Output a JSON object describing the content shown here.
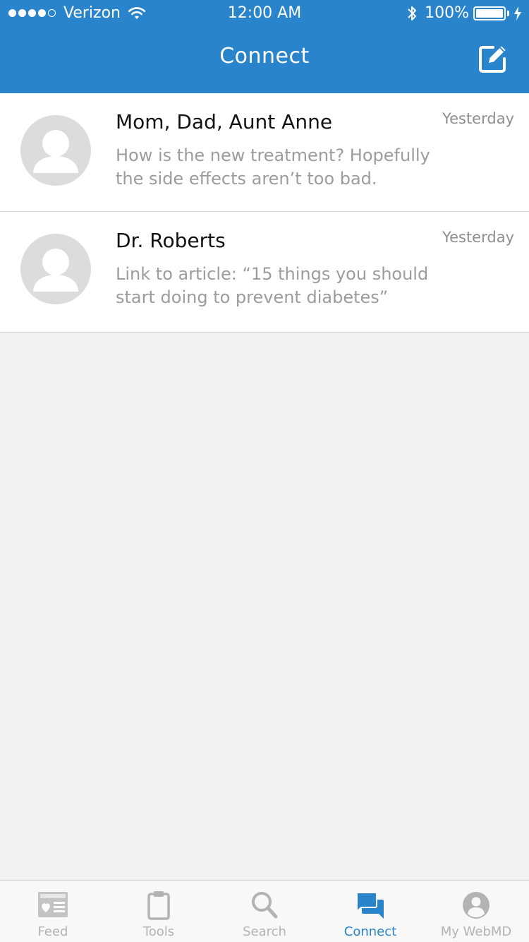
{
  "status_bar": {
    "signal_dots": 5,
    "signal_filled": 4,
    "carrier": "Verizon",
    "time": "12:00 AM",
    "battery_percent": "100%"
  },
  "nav": {
    "title": "Connect",
    "compose_icon": "compose-icon"
  },
  "conversations": [
    {
      "name": "Mom, Dad, Aunt Anne",
      "time": "Yesterday",
      "preview": "How is the new treatment? Hopefully the side effects aren’t too bad."
    },
    {
      "name": "Dr. Roberts",
      "time": "Yesterday",
      "preview": "Link to article: “15 things you should start doing to prevent diabetes”"
    }
  ],
  "tabs": [
    {
      "label": "Feed",
      "icon": "feed-icon",
      "active": false
    },
    {
      "label": "Tools",
      "icon": "clipboard-icon",
      "active": false
    },
    {
      "label": "Search",
      "icon": "search-icon",
      "active": false
    },
    {
      "label": "Connect",
      "icon": "chat-bubbles-icon",
      "active": true
    },
    {
      "label": "My WebMD",
      "icon": "profile-icon",
      "active": false
    }
  ],
  "colors": {
    "brand_blue": "#2a84cc",
    "background": "#f1f1f1",
    "inactive_tab": "#b3b3b3",
    "avatar_placeholder": "#dcdcdc"
  }
}
